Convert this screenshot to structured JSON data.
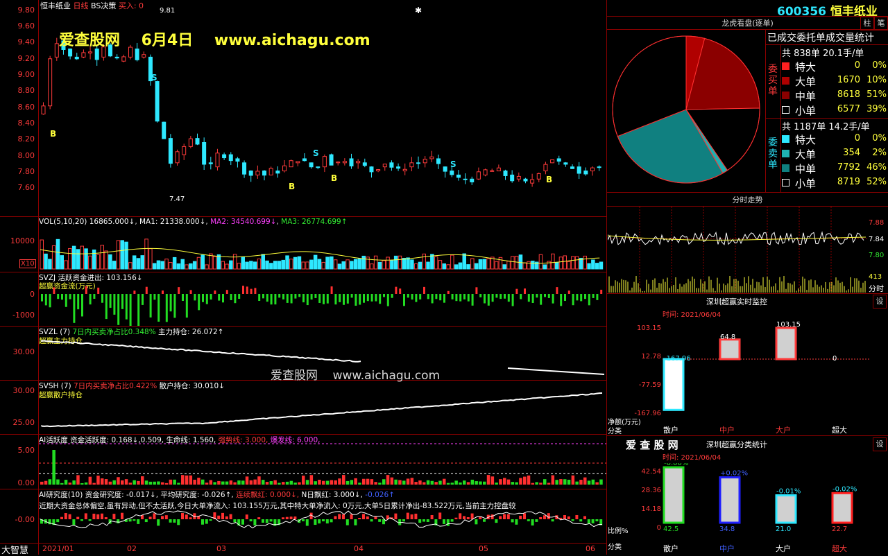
{
  "stock": {
    "code": "600356",
    "name": "恒丰纸业",
    "title": "恒丰纸业",
    "period": "日线",
    "strategy": "BS决策",
    "signal": "买入: 0",
    "peak": "9.81",
    "low": "7.47"
  },
  "watermark": {
    "site": "爱查股网",
    "date": "6月4日",
    "url": "www.aichagu.com",
    "mid_url": "www.aichagu.com",
    "mid_site": "爱查股网"
  },
  "price_axis": [
    "9.80",
    "9.60",
    "9.40",
    "9.20",
    "9.00",
    "8.80",
    "8.60",
    "8.40",
    "8.20",
    "8.00",
    "7.80",
    "7.60"
  ],
  "markers": {
    "buy": "B",
    "sell": "S"
  },
  "vol": {
    "header": "VOL(5,10,20) 16865.000↓",
    "ma1": "MA1: 21338.000↓",
    "ma2": "MA2: 34540.699↓",
    "ma3": "MA3: 26774.699↑",
    "axis": "10000",
    "unit": "X10"
  },
  "svzj": {
    "header": "SVZJ  活跃资金进出: 103.156↓",
    "sub": "超赢资金流(万元)",
    "ax0": "0",
    "ax1": "-1000"
  },
  "svzl": {
    "header": "SVZL (7)",
    "hl": "7日内买卖净占比0.348%",
    "rest": "主力持仓: 26.072↑",
    "sub": "超赢主力持仓",
    "ax": "30.00"
  },
  "svsh": {
    "header": "SVSH (7)",
    "hl": "7日内买卖净占比0.422%",
    "rest": "散户持仓: 30.010↓",
    "sub": "超赢散户持仓",
    "ax0": "30.00",
    "ax1": "25.00"
  },
  "ai1": {
    "a": "AI活跃度  资金活跃度: 0.168↓,0.509,",
    "b": "生命线: 1.560,",
    "c": "强势线: 3.000,",
    "d": "爆发线: 6.000,",
    "ax0": "5.00",
    "ax1": "0.00"
  },
  "ai2": {
    "a": "AI研究度(10) 资金研究度: -0.017↓,",
    "b": "平均研究度: -0.026↑,",
    "c": "连续飘红: 0.000↓,",
    "d": "N日飘红: 3.000↓,",
    "e": "-0.026↑",
    "ax": "-0.00",
    "note": "近期大资金总体偏空,虽有异动,但不太活跃,今日大单净流入: 103.155万元,其中特大单净流入: 0万元,大单5日累计净出-83.522万元,当前主力控盘较"
  },
  "xaxis": [
    "2021/01",
    "02",
    "03",
    "04",
    "05",
    "06"
  ],
  "brand": "大智慧",
  "right": {
    "code": "600356",
    "name": "恒丰纸业",
    "btn1": "柱",
    "btn2": "笔",
    "lhb_title": "龙虎看盘(逐单)",
    "stat_title": "已成交委托单成交量统计",
    "buy": {
      "total": "共 838单 20.1手/单",
      "label": "委买单",
      "rows": [
        [
          "特大",
          "0",
          "0%"
        ],
        [
          "大单",
          "1670",
          "10%"
        ],
        [
          "中单",
          "8618",
          "51%"
        ],
        [
          "小单",
          "6577",
          "39%"
        ]
      ]
    },
    "sell": {
      "total": "共 1187单 14.2手/单",
      "label": "委卖单",
      "rows": [
        [
          "特大",
          "0",
          "0%"
        ],
        [
          "大单",
          "354",
          "2%"
        ],
        [
          "中单",
          "7792",
          "46%"
        ],
        [
          "小单",
          "8719",
          "52%"
        ]
      ]
    },
    "pie": [
      {
        "label": "特大买",
        "value": 0,
        "color": "#ff2020"
      },
      {
        "label": "大单买",
        "value": 10,
        "color": "#b00000"
      },
      {
        "label": "中单买",
        "value": 51,
        "color": "#8b0000"
      },
      {
        "label": "小单买",
        "value": 39,
        "color": "#000000"
      },
      {
        "label": "特大卖",
        "value": 0,
        "color": "#2ee8ff"
      },
      {
        "label": "大单卖",
        "value": 2,
        "color": "#20b0b0"
      },
      {
        "label": "中单卖",
        "value": 46,
        "color": "#108080"
      },
      {
        "label": "小单卖",
        "value": 52,
        "color": "#000000"
      }
    ],
    "fs_title": "分时走势",
    "fs_ax": [
      "7.88",
      "7.84",
      "7.80"
    ],
    "fs_vol": "413",
    "fs_time": "分时",
    "mon_title": "深圳超赢实时监控",
    "mon_btn": "设",
    "mon_time": "时间: 2021/06/04",
    "mon_ax": [
      "103.15",
      "12.78",
      "-77.59",
      "-167.96"
    ],
    "mon_vals": [
      "-167.96",
      "64.8",
      "103.15",
      "0"
    ],
    "mon_unit": "净额(万元)",
    "mon_cat": "分类",
    "cats": [
      "散户",
      "中户",
      "大户",
      "超大"
    ],
    "stat_brand": "爱 查 股 网",
    "cls_title": "深圳超赢分类统计",
    "cls_btn": "设",
    "cls_time": "时间: 2021/06/04",
    "cls_ax": [
      "42.54",
      "28.36",
      "14.18",
      "0"
    ],
    "cls_top": [
      "-0.00%",
      "+0.02%",
      "-0.01%",
      "-0.02%"
    ],
    "cls_vals": [
      "42.5",
      "34.8",
      "21.0",
      "22.7"
    ],
    "cls_pct": "比例%",
    "cls_cat": "分类"
  }
}
